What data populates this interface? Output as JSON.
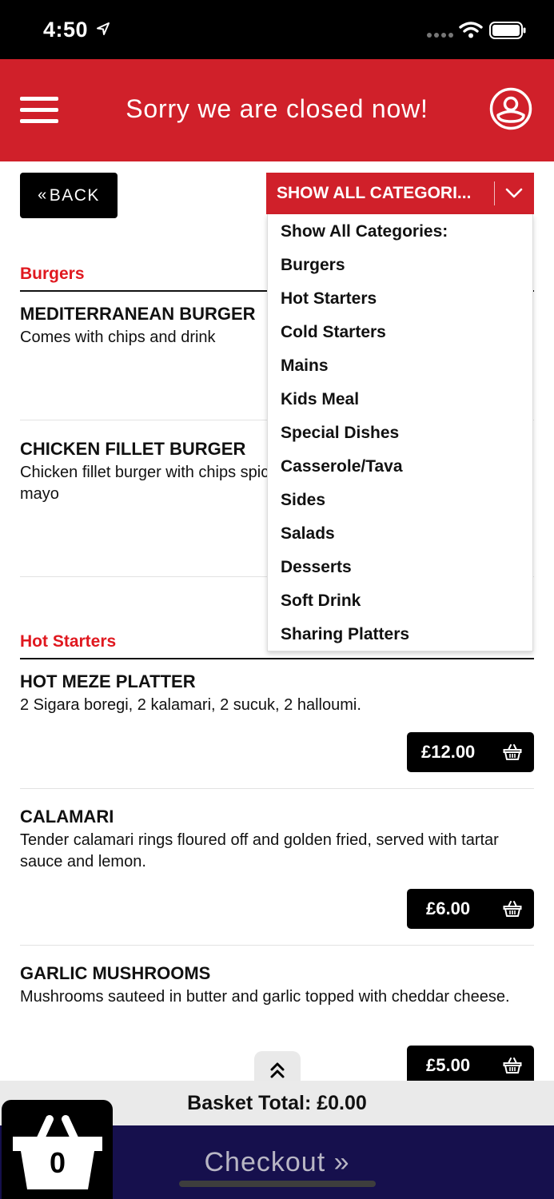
{
  "status_bar": {
    "time": "4:50"
  },
  "header": {
    "title": "Sorry we are closed now!"
  },
  "back_button": {
    "label": "BACK"
  },
  "category_select": {
    "selected_label": "SHOW ALL CATEGORI...",
    "options": [
      "Show All Categories:",
      "Burgers",
      "Hot Starters",
      "Cold Starters",
      "Mains",
      "Kids Meal",
      "Special Dishes",
      "Casserole/Tava",
      "Sides",
      "Salads",
      "Desserts",
      "Soft Drink",
      "Sharing Platters"
    ]
  },
  "sections": [
    {
      "title": "Burgers",
      "items": [
        {
          "title": "MEDITERRANEAN BURGER",
          "desc": "Comes with chips and drink"
        },
        {
          "title": "CHICKEN FILLET BURGER",
          "desc": "Chicken fillet burger with chips spicy mayo"
        }
      ]
    },
    {
      "title": "Hot Starters",
      "items": [
        {
          "title": "HOT MEZE PLATTER",
          "desc": "2 Sigara boregi, 2 kalamari, 2 sucuk, 2 halloumi.",
          "price": "£12.00"
        },
        {
          "title": "CALAMARI",
          "desc": "Tender calamari rings floured off and golden fried, served with tartar sauce and lemon.",
          "price": "£6.00"
        },
        {
          "title": "GARLIC MUSHROOMS",
          "desc": "Mushrooms sauteed in butter and garlic topped with cheddar cheese.",
          "price": "£5.00"
        }
      ]
    }
  ],
  "basket": {
    "total_label": "Basket Total: £0.00",
    "count": "0"
  },
  "checkout": {
    "label": "Checkout »"
  },
  "colors": {
    "brand_red": "#d0202a",
    "section_red": "#e0181f",
    "checkout_navy": "#16104d"
  }
}
